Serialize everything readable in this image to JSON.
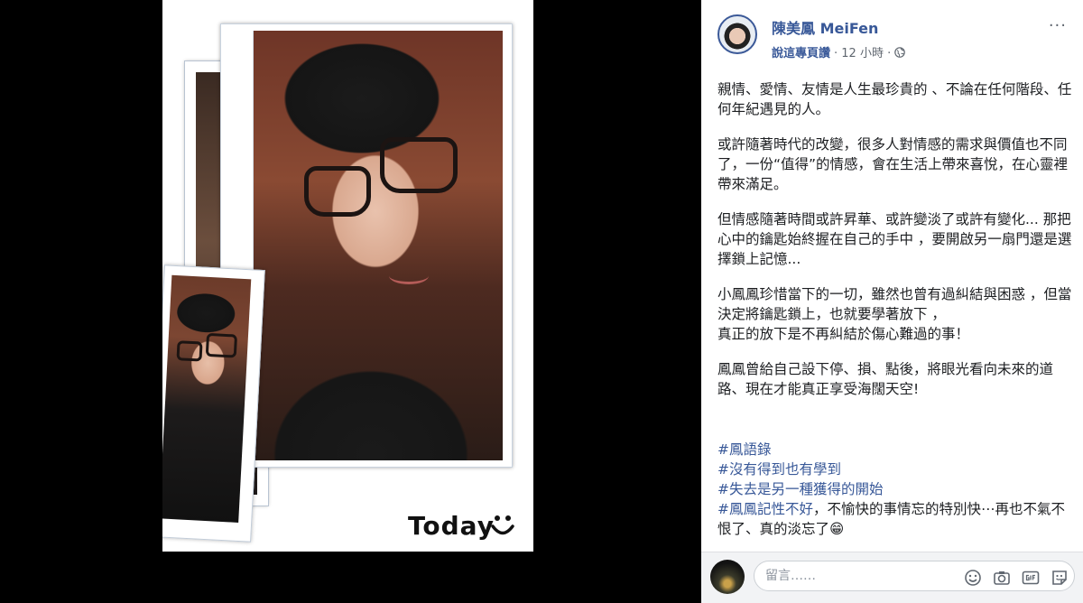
{
  "photo": {
    "caption": "Today"
  },
  "post": {
    "author": "陳美鳳 MeiFen",
    "meta_link": "說這專頁讚",
    "meta_time": "· 12 小時 ·",
    "more": "···",
    "paragraphs": [
      "親情、愛情、友情是人生最珍貴的 、不論在任何階段、任何年紀遇見的人。",
      "或許隨著時代的改變，很多人對情感的需求與價值也不同了，一份“值得”的情感，會在生活上帶來喜悅，在心靈裡帶來滿足。",
      "但情感隨著時間或許昇華、或許變淡了或許有變化... 那把心中的鑰匙始終握在自己的手中 ，要開啟另一扇門還是選擇鎖上記憶...",
      "小鳳鳳珍惜當下的一切，雖然也曾有過糾結與困惑 ，但當決定將鑰匙鎖上，也就要學著放下 ，\n真正的放下是不再糾結於傷心難過的事！",
      "鳳鳳曾給自己設下停、損、點後，將眼光看向未來的道路、現在才能真正享受海闊天空!"
    ],
    "hashtags": [
      "#鳳語錄",
      "#沒有得到也有學到",
      "#失去是另一種獲得的開始",
      "#鳳鳳記性不好"
    ],
    "closing": "，不愉快的事情忘的特別快⋯再也不氣不恨了、真的淡忘了😁"
  },
  "comment": {
    "placeholder": "留言……"
  },
  "icons": [
    "globe-icon",
    "emoji-icon",
    "camera-icon",
    "gif-icon",
    "sticker-icon"
  ],
  "colors": {
    "link": "#385898",
    "background": "#000000",
    "comment_bar": "#f2f3f5"
  }
}
